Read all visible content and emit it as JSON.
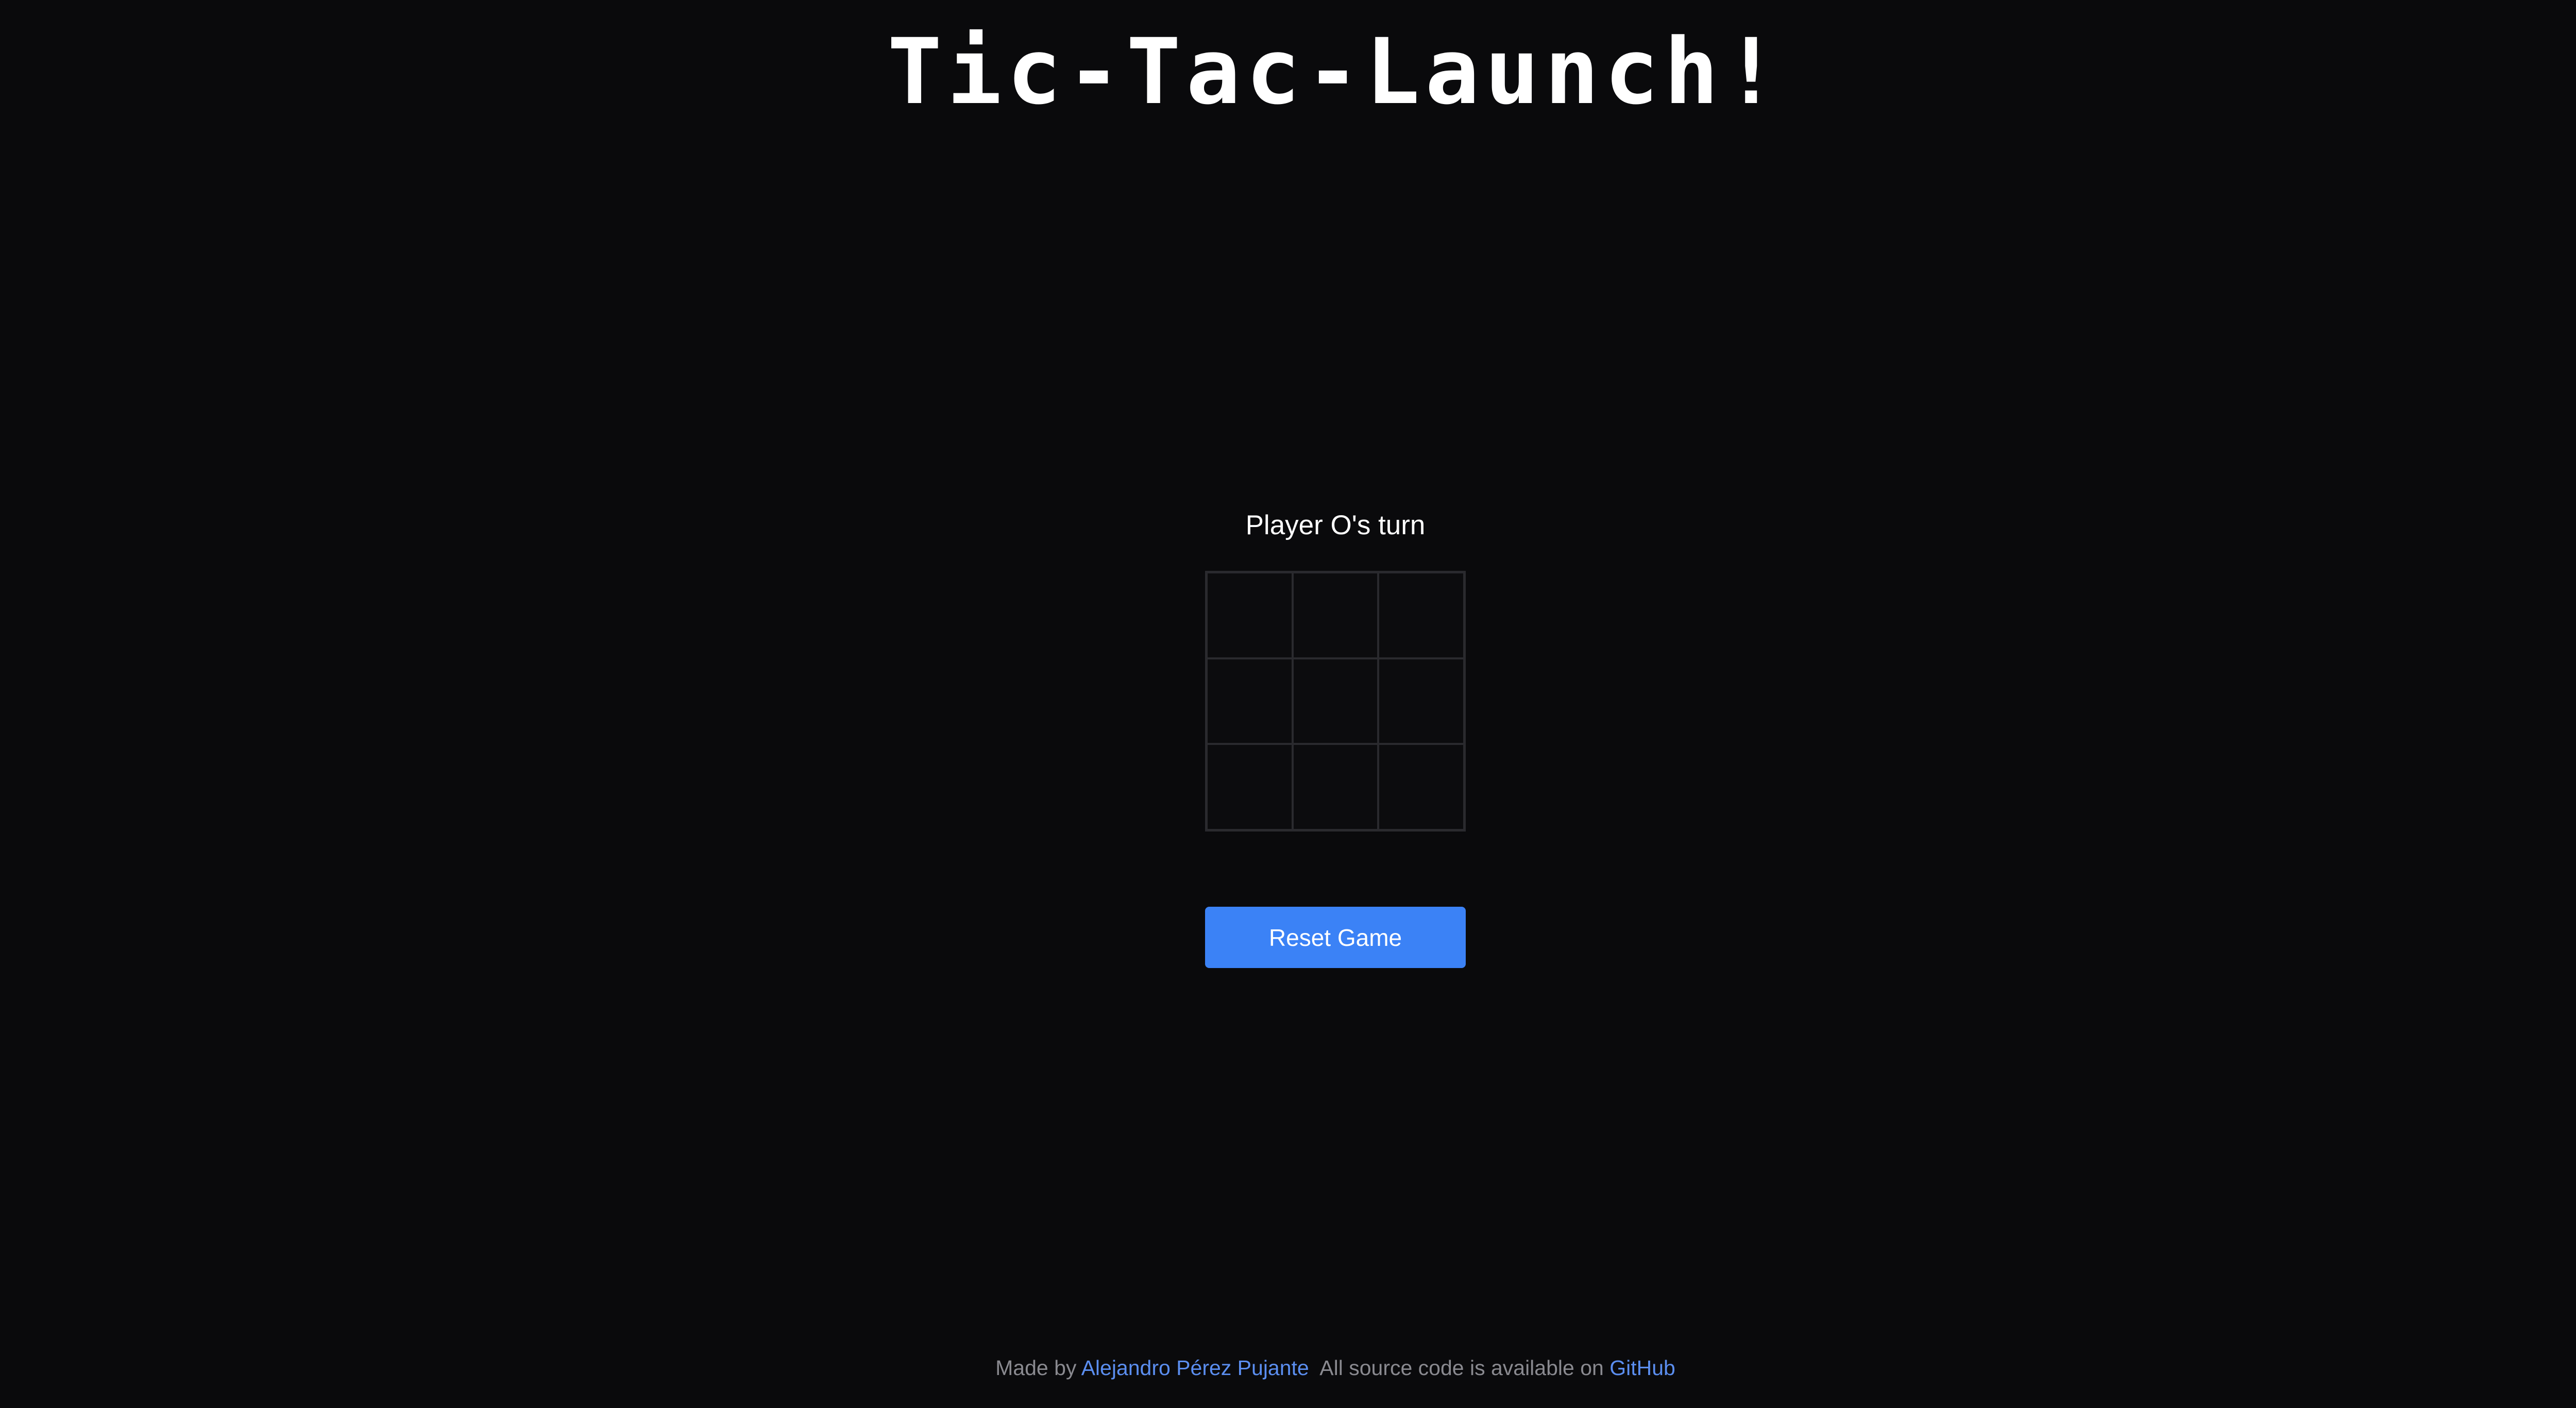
{
  "title": "Tic-Tac-Launch!",
  "status": "Player O's turn",
  "board": {
    "cells": [
      "",
      "",
      "",
      "",
      "",
      "",
      "",
      "",
      ""
    ]
  },
  "reset_button": {
    "label": "Reset Game",
    "color": "#3b82f6"
  },
  "footer": {
    "made_by_prefix": "Made by",
    "author": "Alejandro Pérez Pujante",
    "source_text": "All source code is available on",
    "github": "GitHub",
    "link_color": "#5b8ef0"
  }
}
